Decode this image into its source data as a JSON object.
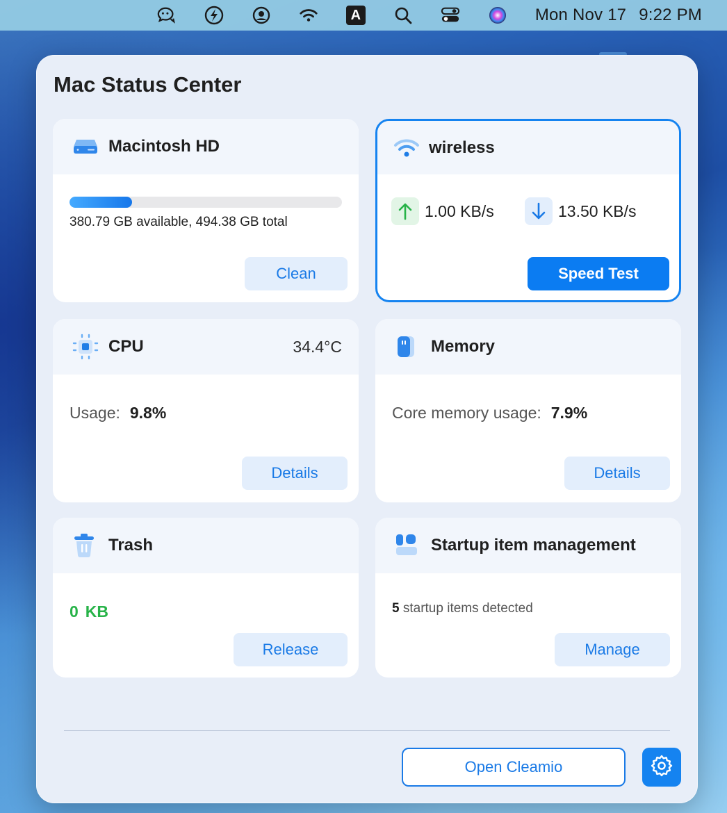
{
  "menubar": {
    "icons": [
      "wechat-icon",
      "bolt-icon",
      "user-circle-icon",
      "wifi-icon",
      "input-source-icon",
      "spotlight-search-icon",
      "control-center-icon",
      "siri-icon"
    ],
    "input_source_letter": "A",
    "date": "Mon Nov 17",
    "time": "9:22 PM"
  },
  "panel": {
    "title": "Mac Status Center"
  },
  "disk": {
    "title": "Macintosh HD",
    "icon": "hard-drive-icon",
    "used_fraction": 0.23,
    "summary": "380.79 GB available, 494.38 GB total",
    "button": "Clean"
  },
  "wireless": {
    "title": "wireless",
    "icon": "wifi-icon",
    "upload": "1.00 KB/s",
    "download": "13.50 KB/s",
    "button": "Speed Test"
  },
  "cpu": {
    "title": "CPU",
    "icon": "cpu-chip-icon",
    "temperature": "34.4°C",
    "usage_label": "Usage:",
    "usage_value": "9.8%",
    "button": "Details"
  },
  "memory": {
    "title": "Memory",
    "icon": "memory-icon",
    "usage_label": "Core memory usage:",
    "usage_value": "7.9%",
    "button": "Details"
  },
  "trash": {
    "title": "Trash",
    "icon": "trash-icon",
    "size_value": "0",
    "size_unit": "KB",
    "button": "Release"
  },
  "startup": {
    "title": "Startup item management",
    "icon": "startup-items-icon",
    "count": "5",
    "detected_text": "startup items detected",
    "button": "Manage"
  },
  "footer": {
    "open_button": "Open Cleamio",
    "settings_icon": "gear-icon"
  },
  "colors": {
    "accent": "#0b7cf2",
    "upload_green": "#27b348",
    "light_button_bg": "#e3eefc",
    "panel_bg": "#e8eef8"
  }
}
